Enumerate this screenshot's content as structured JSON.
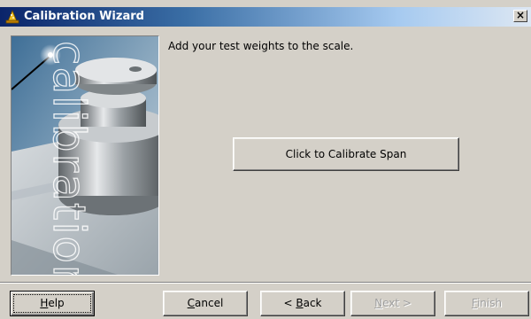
{
  "window": {
    "title": "Calibration Wizard",
    "title_icon": "wizard-hat-icon",
    "close_label": "×"
  },
  "side_panel": {
    "watermark_text": "calibration"
  },
  "main": {
    "instruction": "Add your test weights to the scale.",
    "calibrate_button": "Click to Calibrate Span"
  },
  "footer": {
    "help": {
      "label": "Help",
      "mnemonic": "H",
      "rest": "elp",
      "enabled": true
    },
    "cancel": {
      "label": "Cancel",
      "mnemonic": "C",
      "rest": "ancel",
      "enabled": true
    },
    "back": {
      "label": "< Back",
      "prefix": "< ",
      "mnemonic": "B",
      "rest": "ack",
      "enabled": true
    },
    "next": {
      "label": "Next >",
      "mnemonic": "N",
      "rest": "ext >",
      "enabled": false
    },
    "finish": {
      "label": "Finish",
      "mnemonic": "F",
      "rest": "inish",
      "enabled": false
    }
  },
  "colors": {
    "titlebar_start": "#0a246a",
    "titlebar_end": "#dde7f3",
    "face": "#d4d0c8",
    "disabled_text": "#a0a0a0"
  }
}
